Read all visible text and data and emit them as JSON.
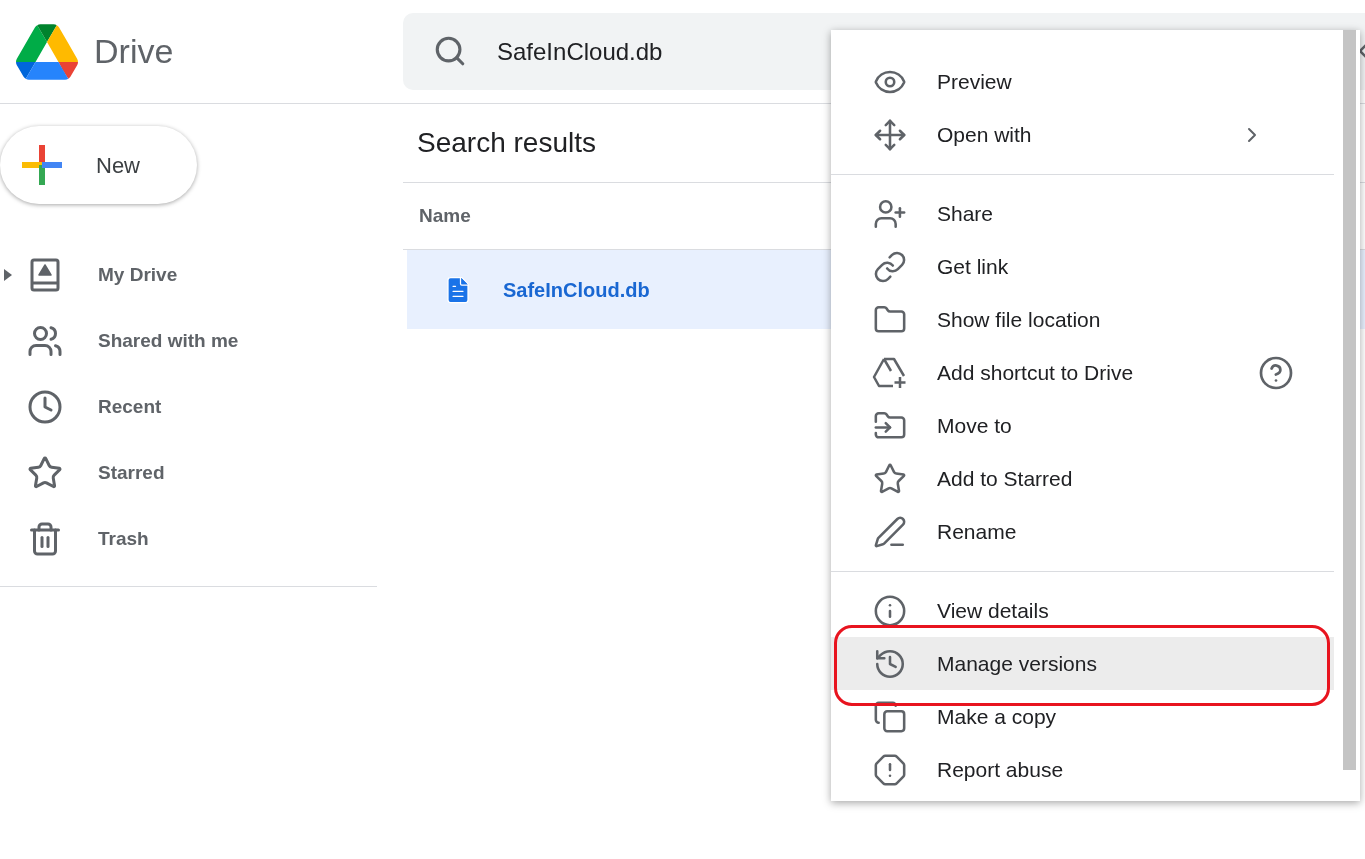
{
  "app": {
    "title": "Drive"
  },
  "search": {
    "value": "SafeInCloud.db"
  },
  "new_button": {
    "label": "New"
  },
  "sidebar": {
    "items": [
      {
        "label": "My Drive",
        "kind": "tree",
        "expanded": false
      },
      {
        "label": "Shared with me",
        "kind": "link"
      },
      {
        "label": "Recent",
        "kind": "link"
      },
      {
        "label": "Starred",
        "kind": "link"
      },
      {
        "label": "Trash",
        "kind": "link"
      }
    ]
  },
  "results": {
    "title": "Search results",
    "columns": [
      "Name"
    ],
    "rows": [
      {
        "name": "SafeInCloud.db",
        "selected": true
      }
    ]
  },
  "context_menu": {
    "groups": [
      [
        {
          "label": "Preview",
          "kind": "plain",
          "hovered": false,
          "circled": false
        },
        {
          "label": "Open with",
          "kind": "submenu",
          "hovered": false,
          "circled": false
        }
      ],
      [
        {
          "label": "Share",
          "kind": "plain",
          "hovered": false,
          "circled": false
        },
        {
          "label": "Get link",
          "kind": "plain",
          "hovered": false,
          "circled": false
        },
        {
          "label": "Show file location",
          "kind": "plain",
          "hovered": false,
          "circled": false
        },
        {
          "label": "Add shortcut to Drive",
          "kind": "help",
          "hovered": false,
          "circled": false
        },
        {
          "label": "Move to",
          "kind": "plain",
          "hovered": false,
          "circled": false
        },
        {
          "label": "Add to Starred",
          "kind": "plain",
          "hovered": false,
          "circled": false
        },
        {
          "label": "Rename",
          "kind": "plain",
          "hovered": false,
          "circled": false
        }
      ],
      [
        {
          "label": "View details",
          "kind": "plain",
          "hovered": false,
          "circled": false
        },
        {
          "label": "Manage versions",
          "kind": "plain",
          "hovered": true,
          "circled": true
        },
        {
          "label": "Make a copy",
          "kind": "plain",
          "hovered": false,
          "circled": false
        },
        {
          "label": "Report abuse",
          "kind": "plain",
          "hovered": false,
          "circled": false
        }
      ]
    ]
  }
}
